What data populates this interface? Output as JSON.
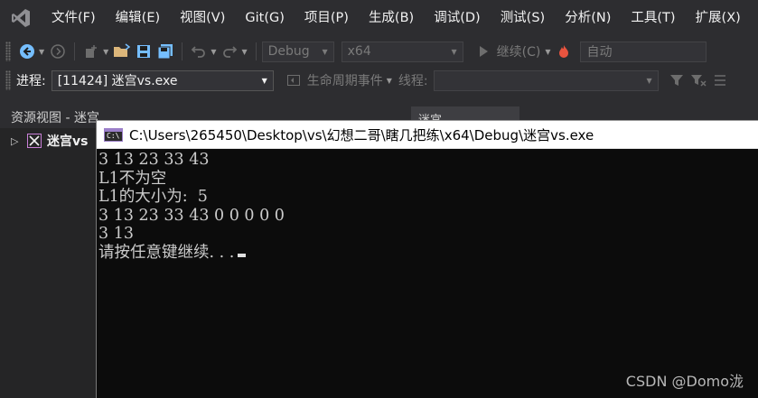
{
  "menu": {
    "items": [
      "文件(F)",
      "编辑(E)",
      "视图(V)",
      "Git(G)",
      "项目(P)",
      "生成(B)",
      "调试(D)",
      "测试(S)",
      "分析(N)",
      "工具(T)",
      "扩展(X)"
    ]
  },
  "toolbar": {
    "config_value": "Debug",
    "platform_value": "x64",
    "continue_label": "继续(C)",
    "auto_value": "自动"
  },
  "debug_bar": {
    "process_label": "进程:",
    "process_value": "[11424] 迷宫vs.exe",
    "lifecycle_label": "生命周期事件",
    "thread_label": "线程:"
  },
  "resource_panel": {
    "title": "资源视图 - 迷宫",
    "tree_item": "迷宫vs",
    "right_tab": "迷宫"
  },
  "console": {
    "title": "C:\\Users\\265450\\Desktop\\vs\\幻想二哥\\瞎几把练\\x64\\Debug\\迷宫vs.exe",
    "lines": [
      "3 13 23 33 43",
      "L1不为空",
      "L1的大小为:  5",
      "3 13 23 33 43 0 0 0 0 0",
      "3 13",
      "请按任意键继续. . ."
    ]
  },
  "watermark": "CSDN @Domo泷",
  "colors": {
    "ide_bg": "#2d2d30",
    "console_bg": "#0c0c0c",
    "accent_purple": "#68217a",
    "icon_blue": "#75beff"
  }
}
